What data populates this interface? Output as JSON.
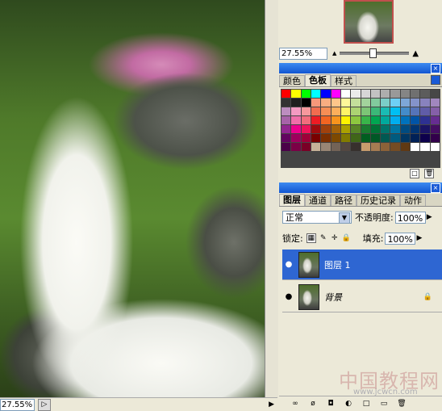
{
  "document": {
    "zoom": "27.55%",
    "status_btn": "▷"
  },
  "navigator": {
    "zoom": "27.55%",
    "mountain_small": "▲",
    "mountain_large": "▲",
    "slider_value": 0.47
  },
  "swatches_panel": {
    "tabs": [
      {
        "label": "颜色"
      },
      {
        "label": "色板"
      },
      {
        "label": "样式"
      }
    ],
    "new_icon": "□",
    "delete_icon": "🗑",
    "colors": [
      "#ff0000",
      "#ffff00",
      "#00ff00",
      "#00ffff",
      "#0000ff",
      "#ff00ff",
      "#ffffff",
      "#ebebeb",
      "#d6d6d6",
      "#c2c2c2",
      "#adadad",
      "#999999",
      "#858585",
      "#707070",
      "#5c5c5c",
      "#474747",
      "#333333",
      "#1f1f1f",
      "#000000",
      "#f7977a",
      "#f9ad81",
      "#fdc68a",
      "#fff79a",
      "#c4df9b",
      "#a2d39c",
      "#82ca9d",
      "#7bcdc8",
      "#6ecff6",
      "#7ea7d8",
      "#8493ca",
      "#8882be",
      "#a187be",
      "#bc8dbf",
      "#f49ac2",
      "#f6989d",
      "#f26c4f",
      "#f68e55",
      "#fbaf5c",
      "#fff467",
      "#acd372",
      "#7cc576",
      "#3bb878",
      "#1abbb4",
      "#00bff3",
      "#438cca",
      "#5574b9",
      "#605ca8",
      "#855fa8",
      "#a763a8",
      "#f06ea9",
      "#f26d7d",
      "#ed1c24",
      "#f26522",
      "#f7941d",
      "#fff200",
      "#8dc73f",
      "#39b54a",
      "#00a651",
      "#00a99d",
      "#00aeef",
      "#0072bc",
      "#0054a6",
      "#2e3192",
      "#662d91",
      "#92278f",
      "#ec008c",
      "#ed145b",
      "#9e0b0f",
      "#a0410d",
      "#a36209",
      "#aba000",
      "#598527",
      "#1a7b30",
      "#007236",
      "#00746b",
      "#0076a3",
      "#004b80",
      "#003471",
      "#1b1464",
      "#440e62",
      "#630460",
      "#9e005d",
      "#9e0039",
      "#790000",
      "#7b2e00",
      "#7d4900",
      "#827b00",
      "#406618",
      "#005e20",
      "#005826",
      "#005952",
      "#005b7f",
      "#003663",
      "#002157",
      "#0d004c",
      "#32004b",
      "#4b0049",
      "#7b0046",
      "#7a0026",
      "#c7b299",
      "#998675",
      "#736357",
      "#534741",
      "#37302d",
      "#c69c6d",
      "#a67c52",
      "#8c6239",
      "#754c24",
      "#603913",
      "#ffffff",
      "#ffffff",
      "#ffffff"
    ]
  },
  "layers_panel": {
    "tabs": [
      {
        "label": "图层"
      },
      {
        "label": "通道"
      },
      {
        "label": "路径"
      },
      {
        "label": "历史记录"
      },
      {
        "label": "动作"
      }
    ],
    "blend_mode": "正常",
    "opacity_label": "不透明度:",
    "opacity_value": "100%",
    "lock_label": "锁定:",
    "fill_label": "填充:",
    "fill_value": "100%",
    "layers": [
      {
        "name": "图层 1",
        "eye": "●",
        "selected": true
      },
      {
        "name": "背景",
        "eye": "●",
        "lock": "🔒",
        "selected": false
      }
    ],
    "footer_icons": [
      "∞",
      "ø",
      "◘",
      "◐",
      "□",
      "▭",
      "🗑"
    ]
  },
  "watermark": {
    "text": "中国教程网",
    "url": "www.jcwcn.com"
  }
}
